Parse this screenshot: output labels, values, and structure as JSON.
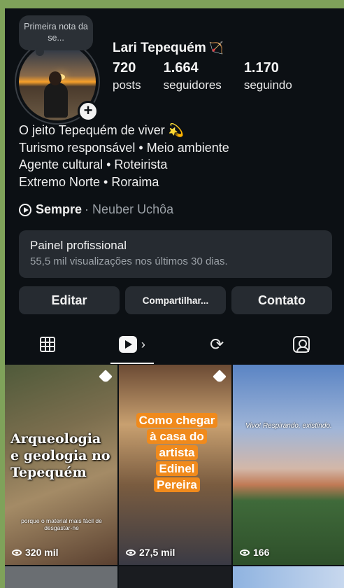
{
  "profile": {
    "note": "Primeira nota da se...",
    "username": "Lari Tepequém",
    "username_emoji": "🏹"
  },
  "stats": [
    {
      "value": "720",
      "label": "posts"
    },
    {
      "value": "1.664",
      "label": "seguidores"
    },
    {
      "value": "1.170",
      "label": "seguindo"
    }
  ],
  "bio": {
    "lines": [
      "O jeito Tepequém de viver 💫",
      "Turismo responsável • Meio ambiente",
      "Agente cultural • Roteirista",
      "Extremo Norte • Roraima"
    ]
  },
  "music": {
    "song": "Sempre",
    "artist": "· Neuber Uchôa"
  },
  "panel": {
    "title": "Painel profissional",
    "subtitle": "55,5 mil visualizações nos últimos 30 dias."
  },
  "buttons": {
    "edit": "Editar",
    "share": "Compartilhar...",
    "contact": "Contato"
  },
  "tabs": {
    "reels_chevron": "›",
    "repost_glyph": "⟳"
  },
  "posts": [
    {
      "title_lines": [
        "Arqueologia",
        "e geologia no",
        "Tepequém"
      ],
      "subtitle": "porque o material mais fácil de desgastar-ne",
      "views": "320 mil",
      "pinned": true
    },
    {
      "title_lines": [
        "Como chegar",
        "à casa do",
        "artista",
        "Edinel",
        "Pereira"
      ],
      "views": "27,5 mil",
      "pinned": true
    },
    {
      "caption": "Vivo! Respirando, existindo.",
      "views": "166",
      "pinned": false
    }
  ]
}
